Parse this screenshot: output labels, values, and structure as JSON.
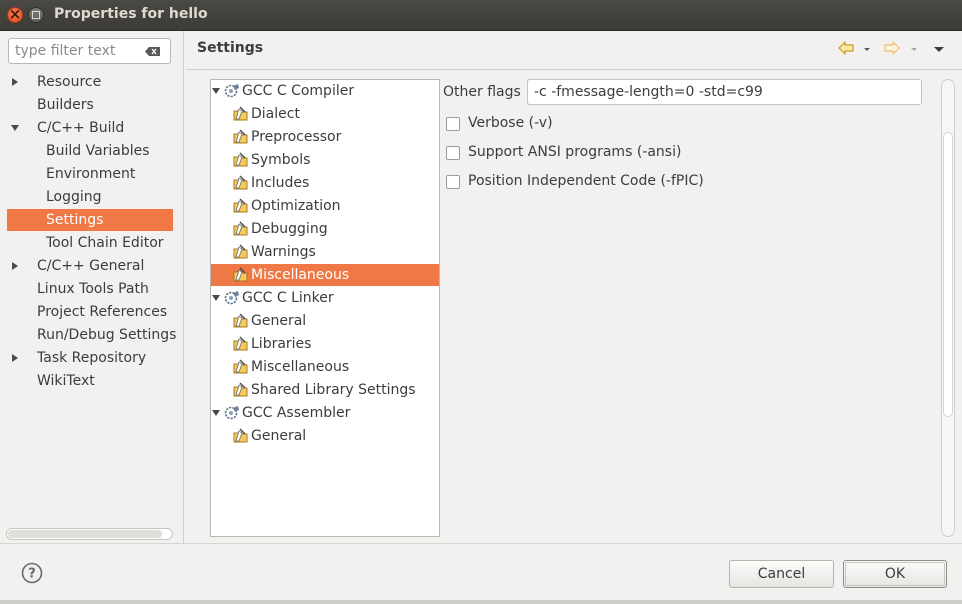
{
  "window": {
    "title": "Properties for hello"
  },
  "filter": {
    "placeholder": "type filter text"
  },
  "nav": [
    {
      "label": "Resource",
      "expand": "collapsed",
      "indent": 0,
      "selected": false
    },
    {
      "label": "Builders",
      "expand": "none",
      "indent": 0,
      "selected": false
    },
    {
      "label": "C/C++ Build",
      "expand": "expanded",
      "indent": 0,
      "selected": false
    },
    {
      "label": "Build Variables",
      "expand": "none",
      "indent": 1,
      "selected": false
    },
    {
      "label": "Environment",
      "expand": "none",
      "indent": 1,
      "selected": false
    },
    {
      "label": "Logging",
      "expand": "none",
      "indent": 1,
      "selected": false
    },
    {
      "label": "Settings",
      "expand": "none",
      "indent": 1,
      "selected": true
    },
    {
      "label": "Tool Chain Editor",
      "expand": "none",
      "indent": 1,
      "selected": false
    },
    {
      "label": "C/C++ General",
      "expand": "collapsed",
      "indent": 0,
      "selected": false
    },
    {
      "label": "Linux Tools Path",
      "expand": "none",
      "indent": 0,
      "selected": false
    },
    {
      "label": "Project References",
      "expand": "none",
      "indent": 0,
      "selected": false
    },
    {
      "label": "Run/Debug Settings",
      "expand": "none",
      "indent": 0,
      "selected": false
    },
    {
      "label": "Task Repository",
      "expand": "collapsed",
      "indent": 0,
      "selected": false
    },
    {
      "label": "WikiText",
      "expand": "none",
      "indent": 0,
      "selected": false
    }
  ],
  "page": {
    "title": "Settings"
  },
  "tree": [
    {
      "label": "GCC C Compiler",
      "type": "tool",
      "selected": false
    },
    {
      "label": "Dialect",
      "type": "option",
      "selected": false
    },
    {
      "label": "Preprocessor",
      "type": "option",
      "selected": false
    },
    {
      "label": "Symbols",
      "type": "option",
      "selected": false
    },
    {
      "label": "Includes",
      "type": "option",
      "selected": false
    },
    {
      "label": "Optimization",
      "type": "option",
      "selected": false
    },
    {
      "label": "Debugging",
      "type": "option",
      "selected": false
    },
    {
      "label": "Warnings",
      "type": "option",
      "selected": false
    },
    {
      "label": "Miscellaneous",
      "type": "option",
      "selected": true
    },
    {
      "label": "GCC C Linker",
      "type": "tool",
      "selected": false
    },
    {
      "label": "General",
      "type": "option",
      "selected": false
    },
    {
      "label": "Libraries",
      "type": "option",
      "selected": false
    },
    {
      "label": "Miscellaneous",
      "type": "option",
      "selected": false
    },
    {
      "label": "Shared Library Settings",
      "type": "option",
      "selected": false
    },
    {
      "label": "GCC Assembler",
      "type": "tool",
      "selected": false
    },
    {
      "label": "General",
      "type": "option",
      "selected": false
    }
  ],
  "form": {
    "other_flags_label": "Other flags",
    "other_flags_value": "-c -fmessage-length=0 -std=c99",
    "checkboxes": [
      {
        "label": "Verbose (-v)",
        "checked": false
      },
      {
        "label": "Support ANSI programs (-ansi)",
        "checked": false
      },
      {
        "label": "Position Independent Code (-fPIC)",
        "checked": false
      }
    ]
  },
  "buttons": {
    "cancel": "Cancel",
    "ok": "OK"
  },
  "colors": {
    "selection": "#f07746",
    "titlebar": "#3c3b37",
    "nav_arrow": "#e8a23a"
  }
}
